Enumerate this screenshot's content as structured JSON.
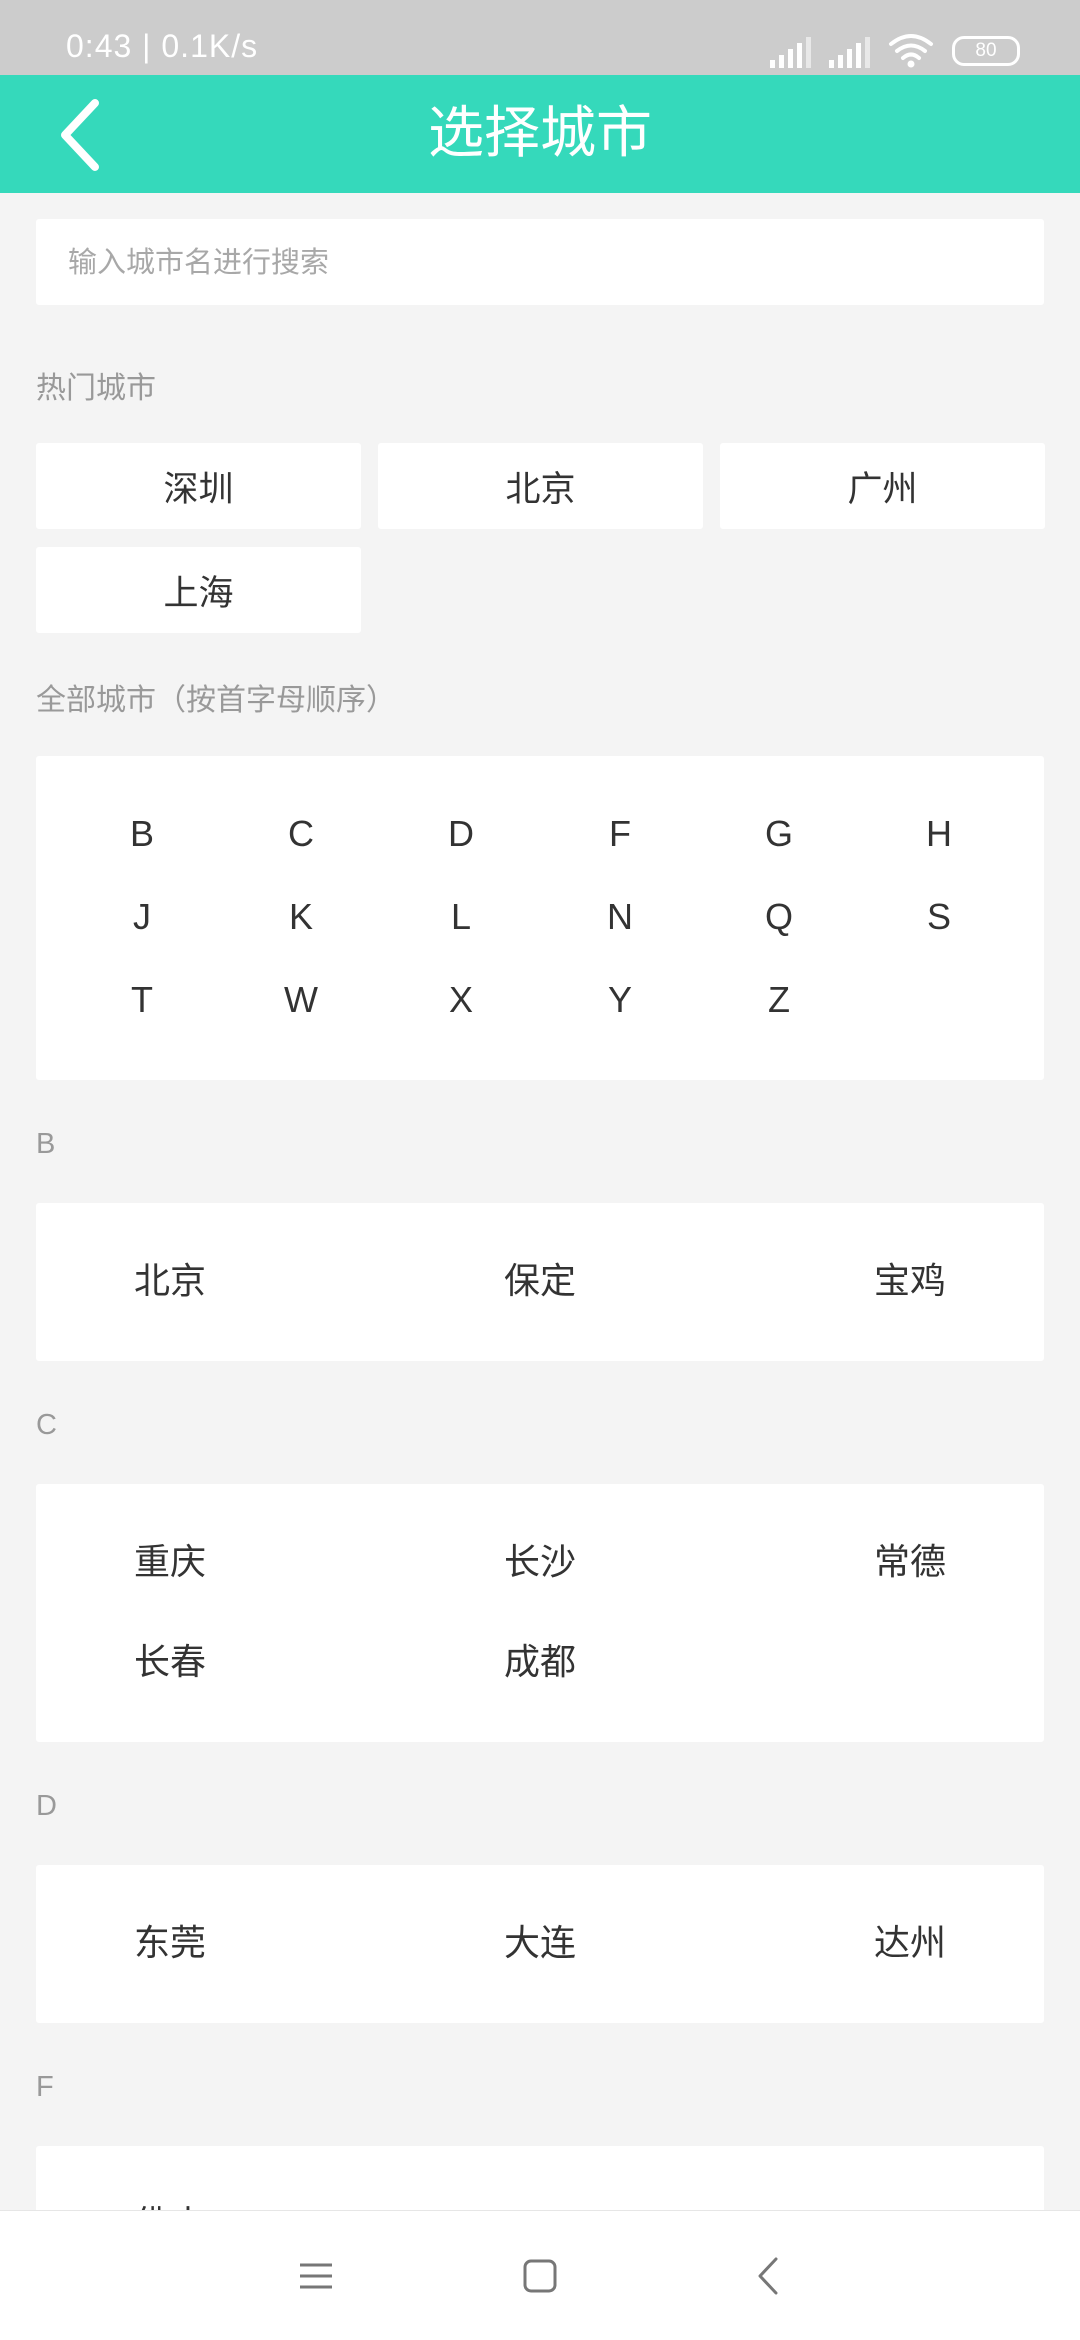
{
  "status_bar": {
    "time_speed": "0:43 | 0.1K/s",
    "battery": "80"
  },
  "header": {
    "title": "选择城市"
  },
  "search": {
    "placeholder": "输入城市名进行搜索"
  },
  "hot": {
    "label": "热门城市",
    "cities": [
      "深圳",
      "北京",
      "广州",
      "上海"
    ]
  },
  "all": {
    "label": "全部城市（按首字母顺序）",
    "letters": [
      "B",
      "C",
      "D",
      "F",
      "G",
      "H",
      "J",
      "K",
      "L",
      "N",
      "Q",
      "S",
      "T",
      "W",
      "X",
      "Y",
      "Z"
    ]
  },
  "groups": [
    {
      "letter": "B",
      "cities": [
        "北京",
        "保定",
        "宝鸡"
      ]
    },
    {
      "letter": "C",
      "cities": [
        "重庆",
        "长沙",
        "常德",
        "长春",
        "成都"
      ]
    },
    {
      "letter": "D",
      "cities": [
        "东莞",
        "大连",
        "达州"
      ]
    },
    {
      "letter": "F",
      "cities": [
        "佛山"
      ]
    }
  ],
  "colors": {
    "accent": "#35d9bb",
    "background": "#f4f4f4",
    "status_bar": "#cccccc"
  },
  "icons": {
    "back": "chevron-left-icon",
    "nav_menu": "menu-icon",
    "nav_home": "square-icon",
    "nav_back": "chevron-left-icon"
  }
}
